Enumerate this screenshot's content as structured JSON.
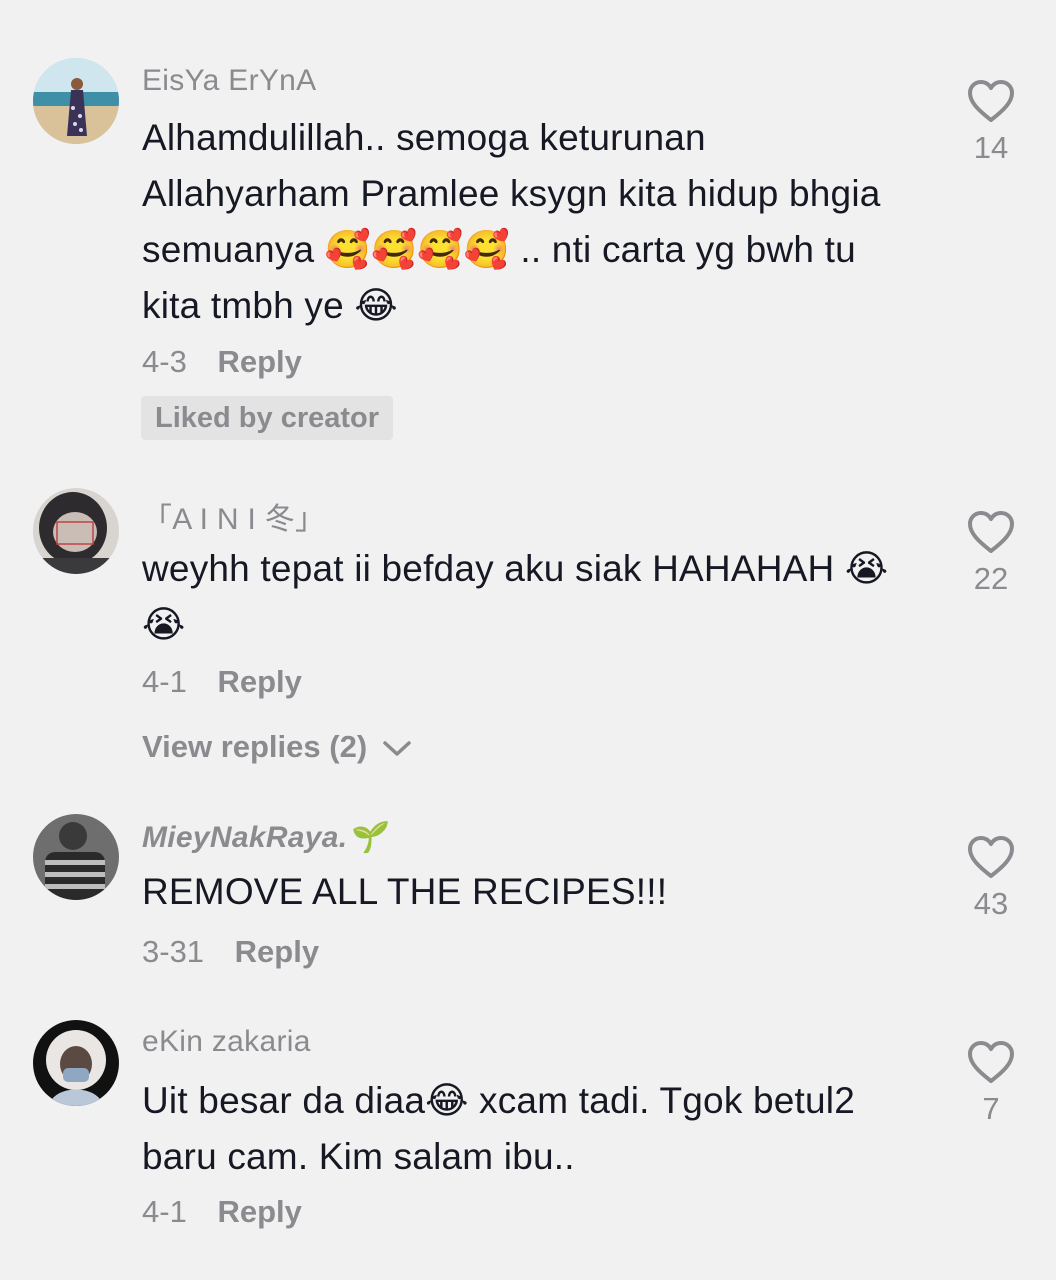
{
  "comments": [
    {
      "username": "EisYa ErYnA",
      "text": "Alhamdulillah.. semoga keturunan Allahyarham Pramlee ksygn kita hidup bhgia semuanya 🥰🥰🥰🥰 .. nti carta yg bwh tu kita tmbh ye 😂",
      "date": "4-3",
      "reply_label": "Reply",
      "badge": "Liked by creator",
      "likes": "14"
    },
    {
      "username": "「A I N I 冬」",
      "text": "weyhh tepat ii befday aku siak HAHAHAH 😭😭",
      "date": "4-1",
      "reply_label": "Reply",
      "view_replies": "View replies (2)",
      "likes": "22"
    },
    {
      "username": "MieyNakRaya.🌱",
      "text": "REMOVE ALL THE RECIPES!!!",
      "date": "3-31",
      "reply_label": "Reply",
      "likes": "43"
    },
    {
      "username": "eKin zakaria",
      "text": "Uit besar da diaa😂 xcam tadi. Tgok betul2 baru cam. Kim salam ibu..",
      "date": "4-1",
      "reply_label": "Reply",
      "likes": "7"
    }
  ],
  "icons": {
    "like": "heart-outline-icon",
    "expand": "chevron-down-icon"
  },
  "colors": {
    "background": "#f2f1f1",
    "text": "#161823",
    "muted": "#8a8a8f",
    "badge_bg": "#e4e3e3"
  }
}
